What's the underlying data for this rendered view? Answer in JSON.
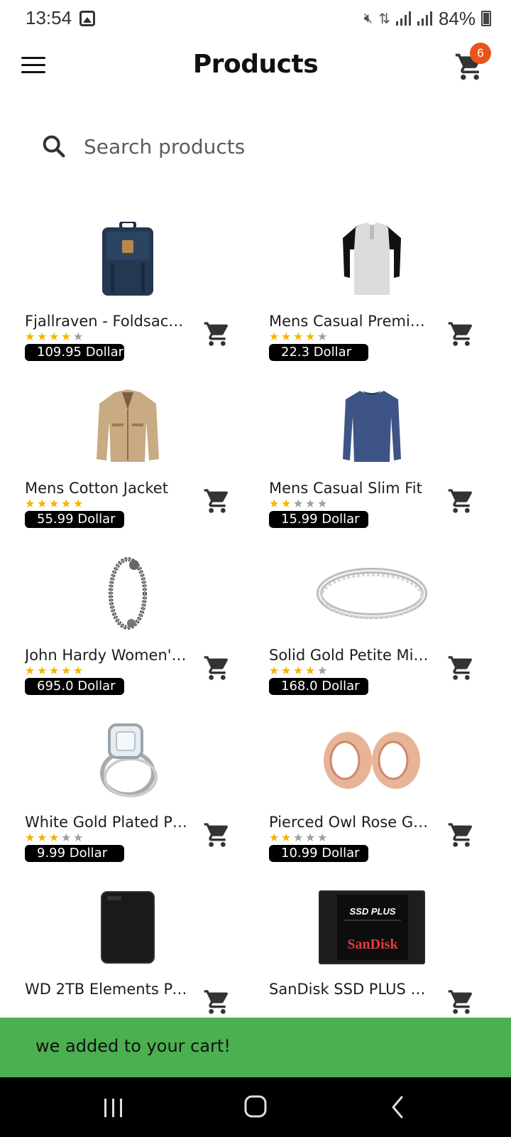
{
  "status_bar": {
    "time": "13:54",
    "battery": "84%"
  },
  "header": {
    "title": "Products",
    "cart_count": "6"
  },
  "search": {
    "placeholder": "Search products"
  },
  "products": [
    {
      "name": "Fjallraven - Foldsac…",
      "rating": 4,
      "price": "109.95 Dollar",
      "image": "backpack"
    },
    {
      "name": "Mens Casual Premi…",
      "rating": 4,
      "price": "22.3 Dollar",
      "image": "tshirt"
    },
    {
      "name": "Mens Cotton Jacket",
      "rating": 5,
      "price": "55.99 Dollar",
      "image": "jacket"
    },
    {
      "name": "Mens Casual Slim Fit",
      "rating": 2,
      "price": "15.99 Dollar",
      "image": "longsleeve"
    },
    {
      "name": "John Hardy Women'…",
      "rating": 5,
      "price": "695.0 Dollar",
      "image": "bracelet"
    },
    {
      "name": "Solid Gold Petite Mi…",
      "rating": 4,
      "price": "168.0 Dollar",
      "image": "ring"
    },
    {
      "name": "White Gold Plated P…",
      "rating": 3,
      "price": "9.99 Dollar",
      "image": "engagement-ring"
    },
    {
      "name": "Pierced Owl Rose G…",
      "rating": 2,
      "price": "10.99 Dollar",
      "image": "plugs"
    },
    {
      "name": "WD 2TB Elements Po…",
      "rating": 0,
      "price": "",
      "image": "hard-drive"
    },
    {
      "name": "SanDisk SSD PLUS 1T…",
      "rating": 0,
      "price": "",
      "image": "ssd",
      "image_text_1": "SSD PLUS",
      "image_text_2": "SanDisk"
    }
  ],
  "snackbar": {
    "message": "we added to your cart!"
  },
  "colors": {
    "accent_badge": "#e8541c",
    "snackbar": "#4caf50",
    "star": "#f5b400"
  }
}
